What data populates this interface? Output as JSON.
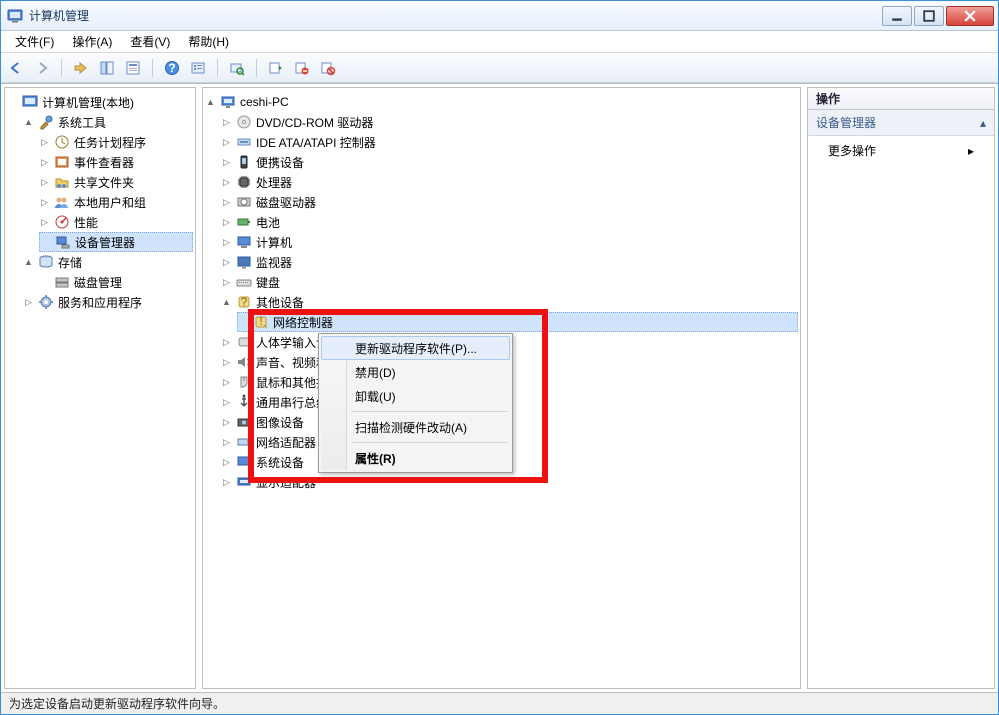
{
  "window": {
    "title": "计算机管理"
  },
  "menu": {
    "file": "文件(F)",
    "action": "操作(A)",
    "view": "查看(V)",
    "help": "帮助(H)"
  },
  "left_tree": {
    "root": "计算机管理(本地)",
    "system_tools": "系统工具",
    "task_scheduler": "任务计划程序",
    "event_viewer": "事件查看器",
    "shared_folders": "共享文件夹",
    "local_users": "本地用户和组",
    "performance": "性能",
    "device_manager": "设备管理器",
    "storage": "存储",
    "disk_management": "磁盘管理",
    "services_apps": "服务和应用程序"
  },
  "center_tree": {
    "root": "ceshi-PC",
    "dvd": "DVD/CD-ROM 驱动器",
    "ide": "IDE ATA/ATAPI 控制器",
    "portable": "便携设备",
    "processor": "处理器",
    "disk_drives": "磁盘驱动器",
    "battery": "电池",
    "computer": "计算机",
    "monitor": "监视器",
    "keyboard": "键盘",
    "other_devices": "其他设备",
    "network_controller": "网络控制器",
    "hid": "人体学输入设备",
    "sound": "声音、视频和游戏控制器",
    "mouse": "鼠标和其他指针设备",
    "usb": "通用串行总线控制器",
    "image": "图像设备",
    "network_adapters": "网络适配器",
    "system_devices": "系统设备",
    "display": "显示适配器"
  },
  "context_menu": {
    "update_driver": "更新驱动程序软件(P)...",
    "disable": "禁用(D)",
    "uninstall": "卸载(U)",
    "scan": "扫描检测硬件改动(A)",
    "properties": "属性(R)"
  },
  "actions_panel": {
    "header": "操作",
    "section": "设备管理器",
    "more": "更多操作"
  },
  "statusbar": {
    "text": "为选定设备启动更新驱动程序软件向导。"
  },
  "icons": {
    "app": "computer-management-icon"
  }
}
